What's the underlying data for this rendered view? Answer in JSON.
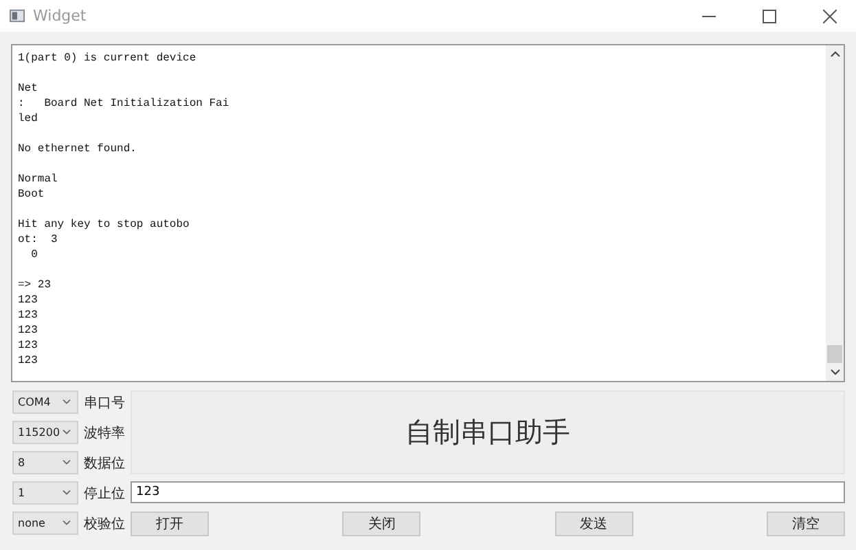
{
  "window": {
    "title": "Widget"
  },
  "log": "1(part 0) is current device\n\nNet\n:   Board Net Initialization Fai\nled\n\nNo ethernet found.\n\nNormal\nBoot\n\nHit any key to stop autobo\not:  3\n  0\n\n=> 23\n123\n123\n123\n123\n123",
  "settings": [
    {
      "value": "COM4",
      "label": "串口号"
    },
    {
      "value": "115200",
      "label": "波特率"
    },
    {
      "value": "8",
      "label": "数据位"
    },
    {
      "value": "1",
      "label": "停止位"
    },
    {
      "value": "none",
      "label": "校验位"
    }
  ],
  "banner": "自制串口助手",
  "send_field": {
    "value": "123"
  },
  "buttons": [
    "打开",
    "关闭",
    "发送",
    "清空"
  ]
}
